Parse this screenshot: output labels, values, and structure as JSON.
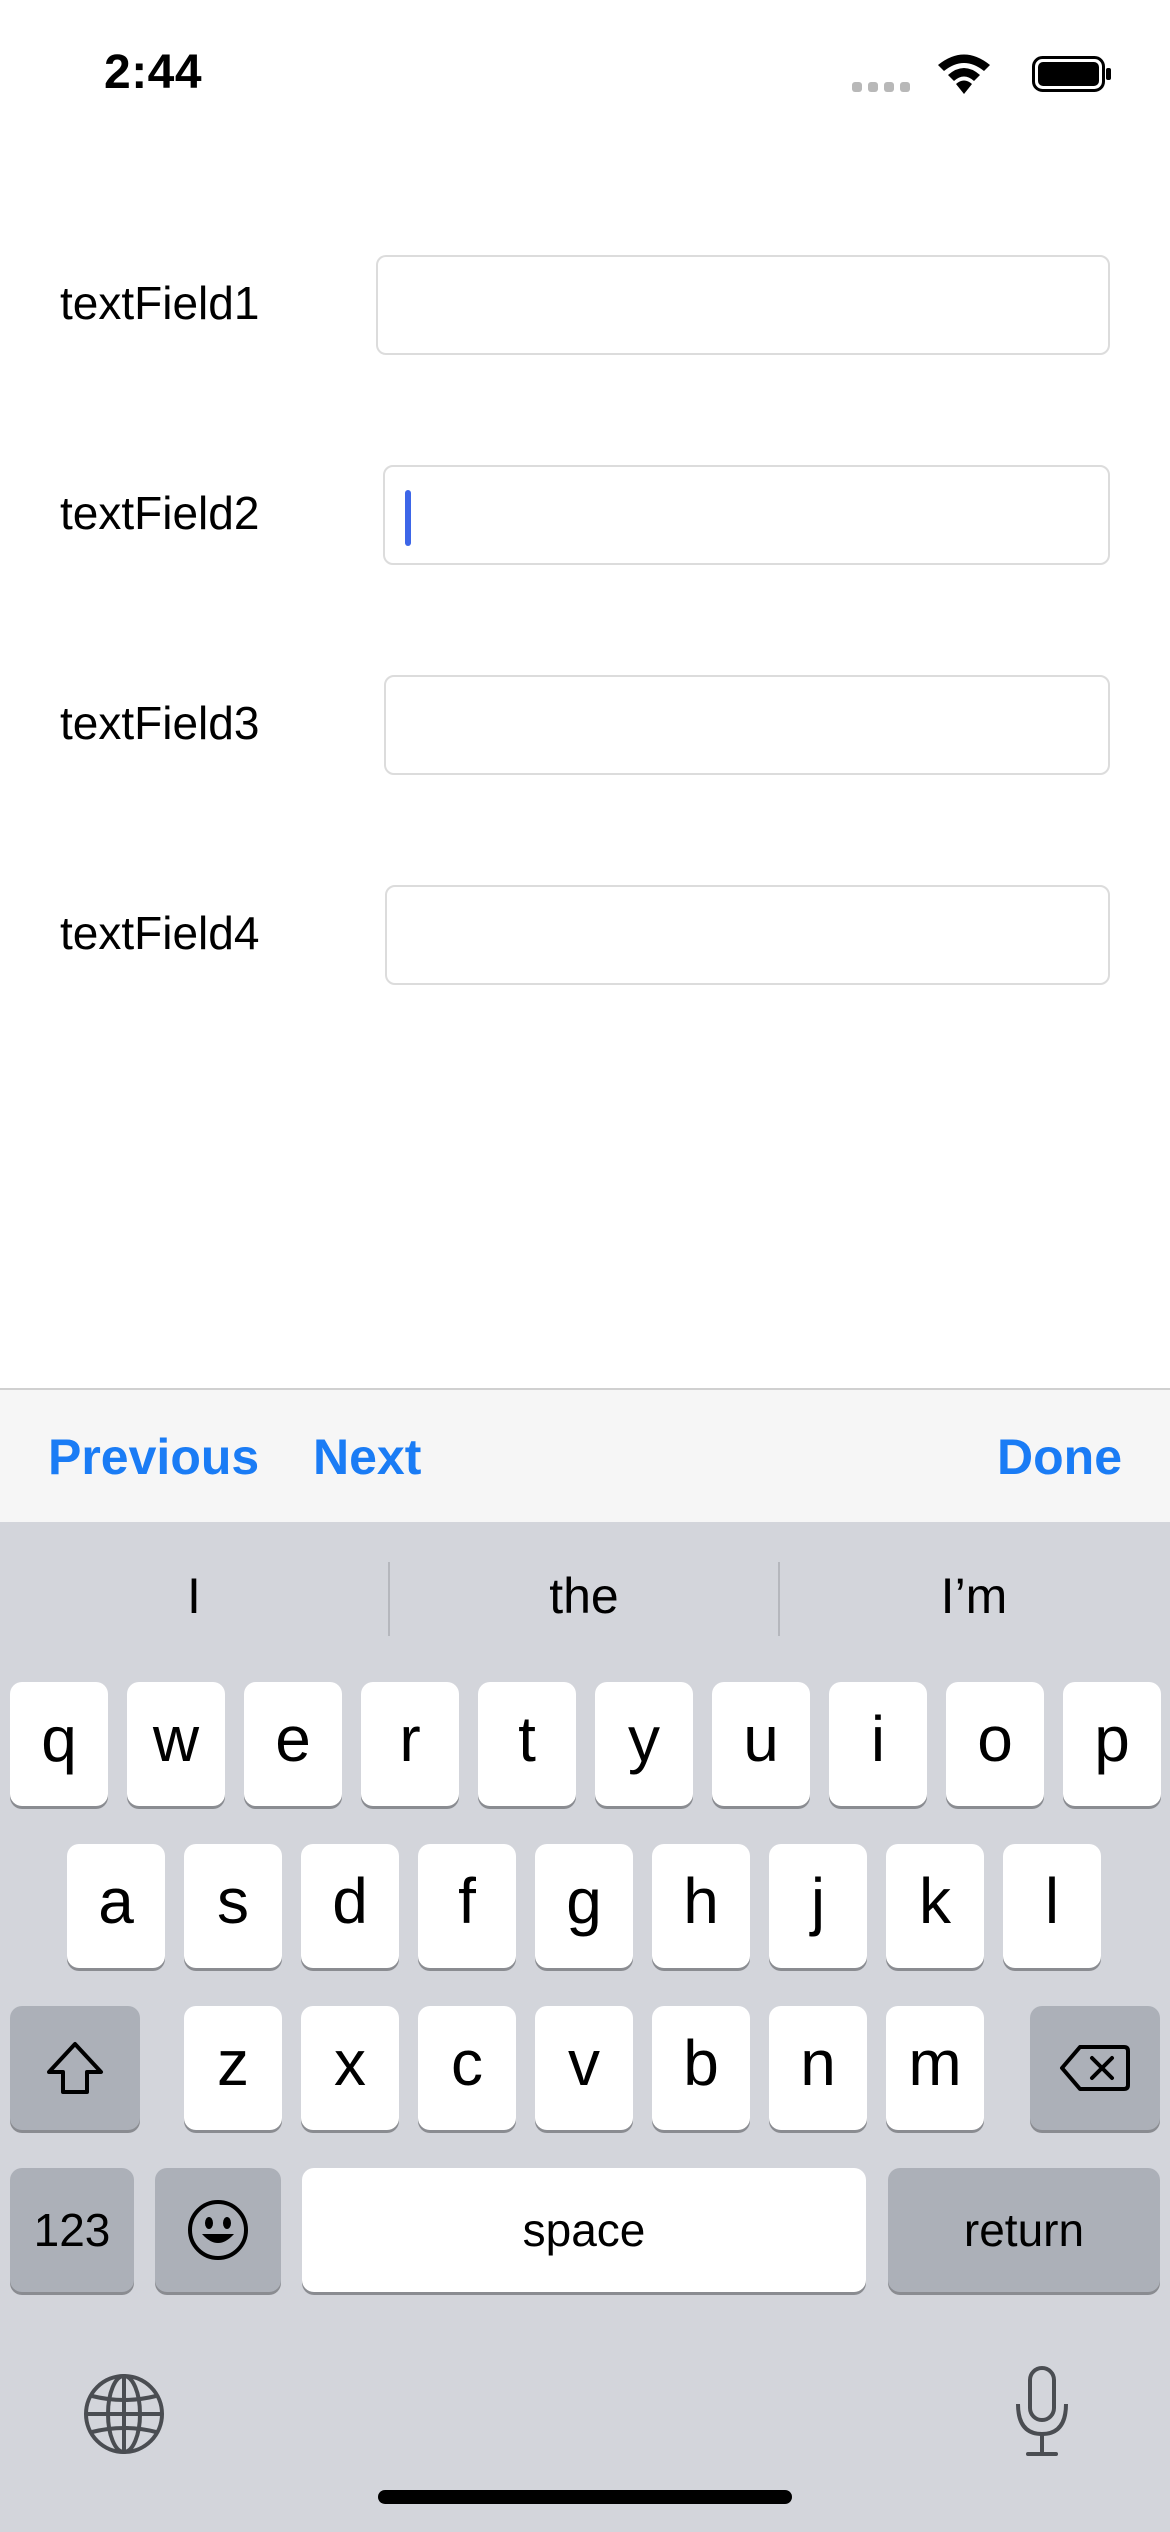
{
  "status_bar": {
    "time": "2:44"
  },
  "form": {
    "fields": [
      {
        "label": "textField1",
        "value": "",
        "focused": false
      },
      {
        "label": "textField2",
        "value": "",
        "focused": true
      },
      {
        "label": "textField3",
        "value": "",
        "focused": false
      },
      {
        "label": "textField4",
        "value": "",
        "focused": false
      }
    ]
  },
  "toolbar": {
    "previous_label": "Previous",
    "next_label": "Next",
    "done_label": "Done",
    "accent_color": "#1a7cf5"
  },
  "keyboard": {
    "suggestions": [
      "I",
      "the",
      "I’m"
    ],
    "row1": [
      "q",
      "w",
      "e",
      "r",
      "t",
      "y",
      "u",
      "i",
      "o",
      "p"
    ],
    "row2": [
      "a",
      "s",
      "d",
      "f",
      "g",
      "h",
      "j",
      "k",
      "l"
    ],
    "row3": [
      "z",
      "x",
      "c",
      "v",
      "b",
      "n",
      "m"
    ],
    "numbers_label": "123",
    "space_label": "space",
    "return_label": "return",
    "icons": {
      "shift": "shift-icon",
      "delete": "delete-icon",
      "emoji": "emoji-icon",
      "globe": "globe-icon",
      "mic": "microphone-icon"
    }
  }
}
